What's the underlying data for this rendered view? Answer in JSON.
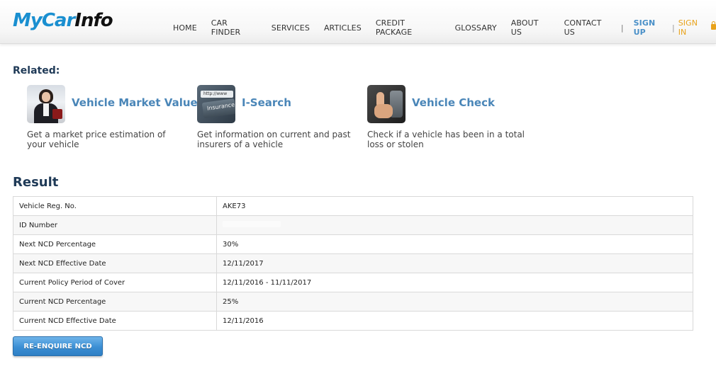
{
  "header": {
    "logo_prefix": "MyCar",
    "logo_suffix": "Info",
    "nav": [
      {
        "label": "HOME"
      },
      {
        "label": "CAR FINDER"
      },
      {
        "label": "SERVICES"
      },
      {
        "label": "ARTICLES"
      },
      {
        "label": "CREDIT PACKAGE"
      },
      {
        "label": "GLOSSARY"
      },
      {
        "label": "ABOUT US"
      },
      {
        "label": "CONTACT US"
      }
    ],
    "separator": "|",
    "sign_up": "SIGN UP",
    "sign_in": "SIGN IN"
  },
  "related": {
    "title": "Related:",
    "items": [
      {
        "title": "Vehicle Market Value",
        "description": "Get a market price estimation of your vehicle",
        "icon": "businesswoman-photo-icon"
      },
      {
        "title": "I-Search",
        "description": "Get information on current and past insurers of a vehicle",
        "icon": "insurance-search-icon",
        "icon_url_text": "http://www",
        "icon_key_text": "Insurance"
      },
      {
        "title": "Vehicle Check",
        "description": "Check if a vehicle has been in a total loss or stolen",
        "icon": "thumbs-up-icon"
      }
    ]
  },
  "result": {
    "title": "Result",
    "rows": [
      {
        "label": "Vehicle Reg. No.",
        "value": "AKE73"
      },
      {
        "label": "ID Number",
        "value": ""
      },
      {
        "label": "Next NCD Percentage",
        "value": "30%"
      },
      {
        "label": "Next NCD Effective Date",
        "value": "12/11/2017"
      },
      {
        "label": "Current Policy Period of Cover",
        "value": "12/11/2016 - 11/11/2017"
      },
      {
        "label": "Current NCD Percentage",
        "value": "25%"
      },
      {
        "label": "Current NCD Effective Date",
        "value": "12/11/2016"
      }
    ]
  },
  "actions": {
    "reenquire_label": "RE-ENQUIRE NCD"
  },
  "colors": {
    "brand_blue": "#1a8fd0",
    "heading": "#1f3a57",
    "link": "#4a86b8",
    "sign_in": "#e8a21a",
    "button": "#3b8fd4"
  }
}
